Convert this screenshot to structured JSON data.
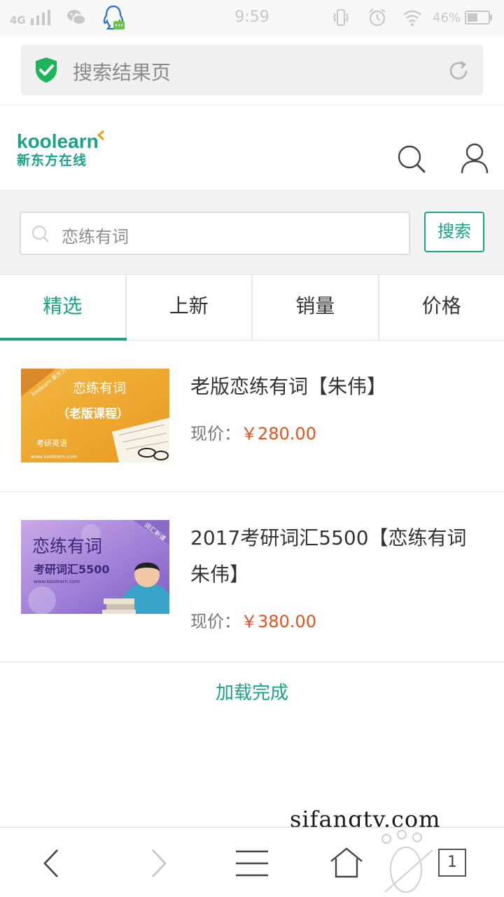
{
  "status_bar": {
    "network": "4G",
    "time": "9:59",
    "battery": "46%",
    "icons": [
      "signal-icon",
      "wechat-icon",
      "qq-icon",
      "vibrate-icon",
      "alarm-icon",
      "wifi-icon",
      "battery-icon"
    ]
  },
  "address_bar": {
    "title": "搜索结果页",
    "icons": [
      "shield-check-icon",
      "reload-icon"
    ]
  },
  "site_header": {
    "logo_en": "koolearn",
    "logo_cn": "新东方在线",
    "icons": [
      "search-icon",
      "user-icon"
    ]
  },
  "search": {
    "query": "恋练有词",
    "button_label": "搜索"
  },
  "tabs": [
    {
      "label": "精选",
      "active": true
    },
    {
      "label": "上新",
      "active": false
    },
    {
      "label": "销量",
      "active": false
    },
    {
      "label": "价格",
      "active": false
    }
  ],
  "results": [
    {
      "name": "老版恋练有词【朱伟】",
      "price_label": "现价：",
      "price": "￥280.00",
      "thumb": {
        "brand": "koolearn 新东方在线",
        "title": "恋练有词",
        "subtitle": "（老版课程）",
        "tag": "考研英语",
        "url": "www.koolearn.com"
      }
    },
    {
      "name": "2017考研词汇5500【恋练有词朱伟】",
      "price_label": "现价：",
      "price": "￥380.00",
      "thumb": {
        "title": "恋练有词",
        "subtitle": "考研词汇5500",
        "corner": "词汇新课",
        "url": "www.koolearn.com"
      }
    }
  ],
  "load_status": "加载完成",
  "watermark": "sifangtv.com",
  "bottom_nav": {
    "tab_count": "1",
    "icons": [
      "back-icon",
      "forward-icon",
      "menu-icon",
      "home-icon",
      "tabs-icon"
    ]
  },
  "colors": {
    "accent": "#1aa386",
    "price": "#e2531f"
  }
}
